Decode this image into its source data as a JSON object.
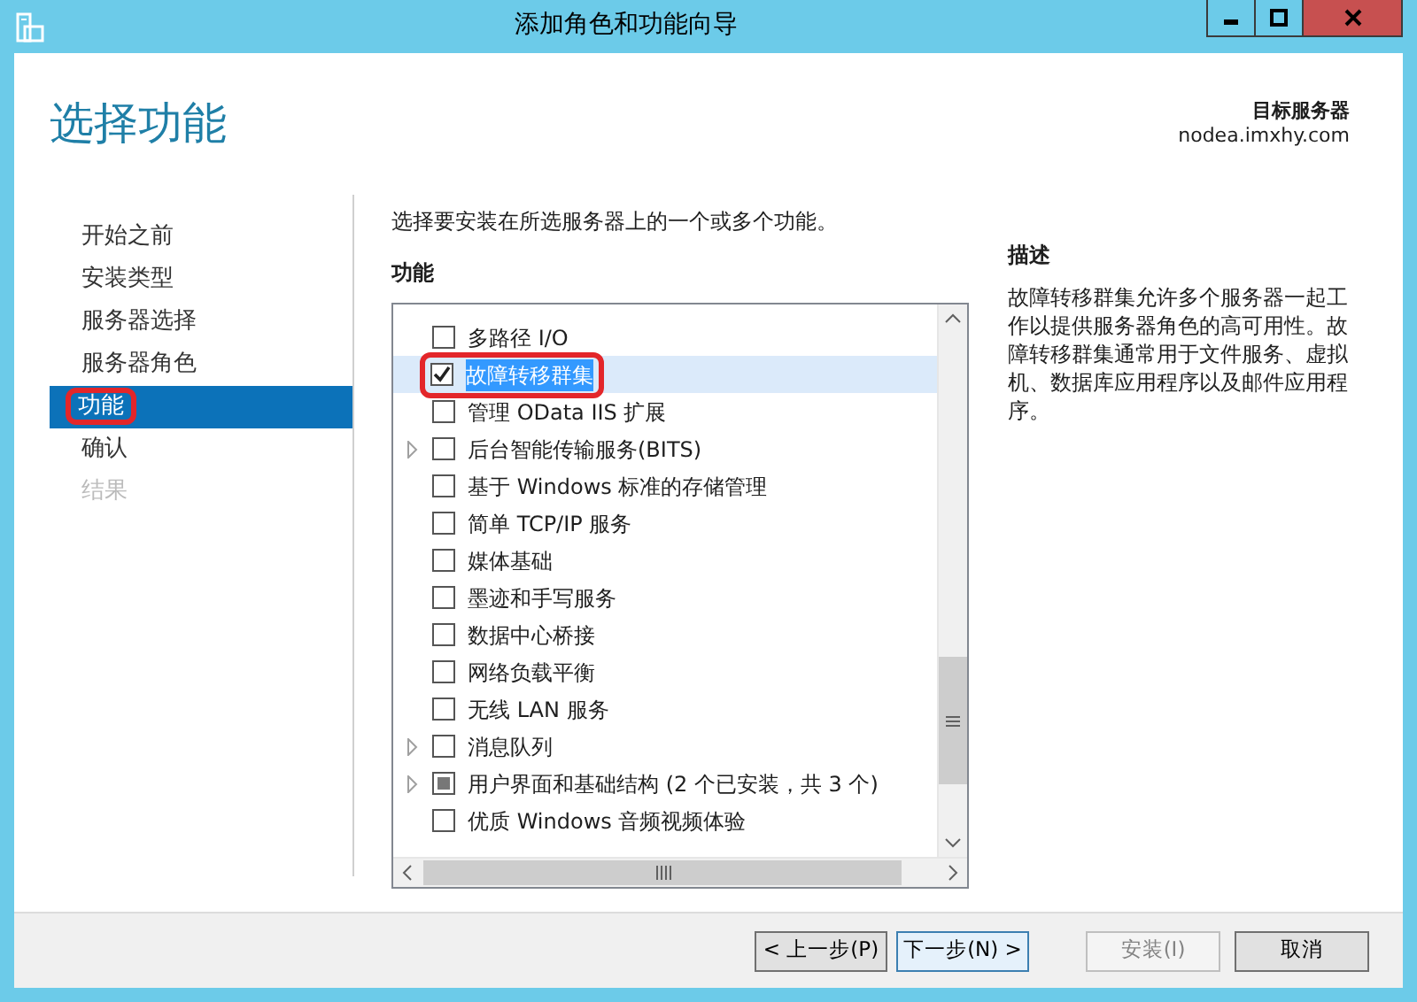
{
  "window": {
    "title": "添加角色和功能向导"
  },
  "header": {
    "title": "选择功能",
    "target_label": "目标服务器",
    "target_server": "nodea.imxhy.com"
  },
  "sidebar": {
    "items": [
      {
        "label": "开始之前",
        "selected": false,
        "disabled": false,
        "highlighted": false
      },
      {
        "label": "安装类型",
        "selected": false,
        "disabled": false,
        "highlighted": false
      },
      {
        "label": "服务器选择",
        "selected": false,
        "disabled": false,
        "highlighted": false
      },
      {
        "label": "服务器角色",
        "selected": false,
        "disabled": false,
        "highlighted": false
      },
      {
        "label": "功能",
        "selected": true,
        "disabled": false,
        "highlighted": true
      },
      {
        "label": "确认",
        "selected": false,
        "disabled": false,
        "highlighted": false
      },
      {
        "label": "结果",
        "selected": false,
        "disabled": true,
        "highlighted": false
      }
    ]
  },
  "instruction": "选择要安装在所选服务器上的一个或多个功能。",
  "features": {
    "heading": "功能",
    "items": [
      {
        "label": "多路径 I/O",
        "checked": false,
        "partial": false,
        "expandable": false,
        "selected": false,
        "highlighted": false
      },
      {
        "label": "故障转移群集",
        "checked": true,
        "partial": false,
        "expandable": false,
        "selected": true,
        "highlighted": true
      },
      {
        "label": "管理 OData IIS 扩展",
        "checked": false,
        "partial": false,
        "expandable": false,
        "selected": false,
        "highlighted": false
      },
      {
        "label": "后台智能传输服务(BITS)",
        "checked": false,
        "partial": false,
        "expandable": true,
        "selected": false,
        "highlighted": false
      },
      {
        "label": "基于 Windows 标准的存储管理",
        "checked": false,
        "partial": false,
        "expandable": false,
        "selected": false,
        "highlighted": false
      },
      {
        "label": "简单 TCP/IP 服务",
        "checked": false,
        "partial": false,
        "expandable": false,
        "selected": false,
        "highlighted": false
      },
      {
        "label": "媒体基础",
        "checked": false,
        "partial": false,
        "expandable": false,
        "selected": false,
        "highlighted": false
      },
      {
        "label": "墨迹和手写服务",
        "checked": false,
        "partial": false,
        "expandable": false,
        "selected": false,
        "highlighted": false
      },
      {
        "label": "数据中心桥接",
        "checked": false,
        "partial": false,
        "expandable": false,
        "selected": false,
        "highlighted": false
      },
      {
        "label": "网络负载平衡",
        "checked": false,
        "partial": false,
        "expandable": false,
        "selected": false,
        "highlighted": false
      },
      {
        "label": "无线 LAN 服务",
        "checked": false,
        "partial": false,
        "expandable": false,
        "selected": false,
        "highlighted": false
      },
      {
        "label": "消息队列",
        "checked": false,
        "partial": false,
        "expandable": true,
        "selected": false,
        "highlighted": false
      },
      {
        "label": "用户界面和基础结构 (2 个已安装，共 3 个)",
        "checked": false,
        "partial": true,
        "expandable": true,
        "selected": false,
        "highlighted": false
      },
      {
        "label": "优质 Windows 音频视频体验",
        "checked": false,
        "partial": false,
        "expandable": false,
        "selected": false,
        "highlighted": false
      }
    ]
  },
  "description": {
    "heading": "描述",
    "text": "故障转移群集允许多个服务器一起工作以提供服务器角色的高可用性。故障转移群集通常用于文件服务、虚拟机、数据库应用程序以及邮件应用程序。"
  },
  "buttons": [
    {
      "label": "< 上一步(P)",
      "focused": false,
      "disabled": false
    },
    {
      "label": "下一步(N) >",
      "focused": true,
      "disabled": false
    },
    {
      "label": "安装(I)",
      "focused": false,
      "disabled": true
    },
    {
      "label": "取消",
      "focused": false,
      "disabled": false
    }
  ]
}
